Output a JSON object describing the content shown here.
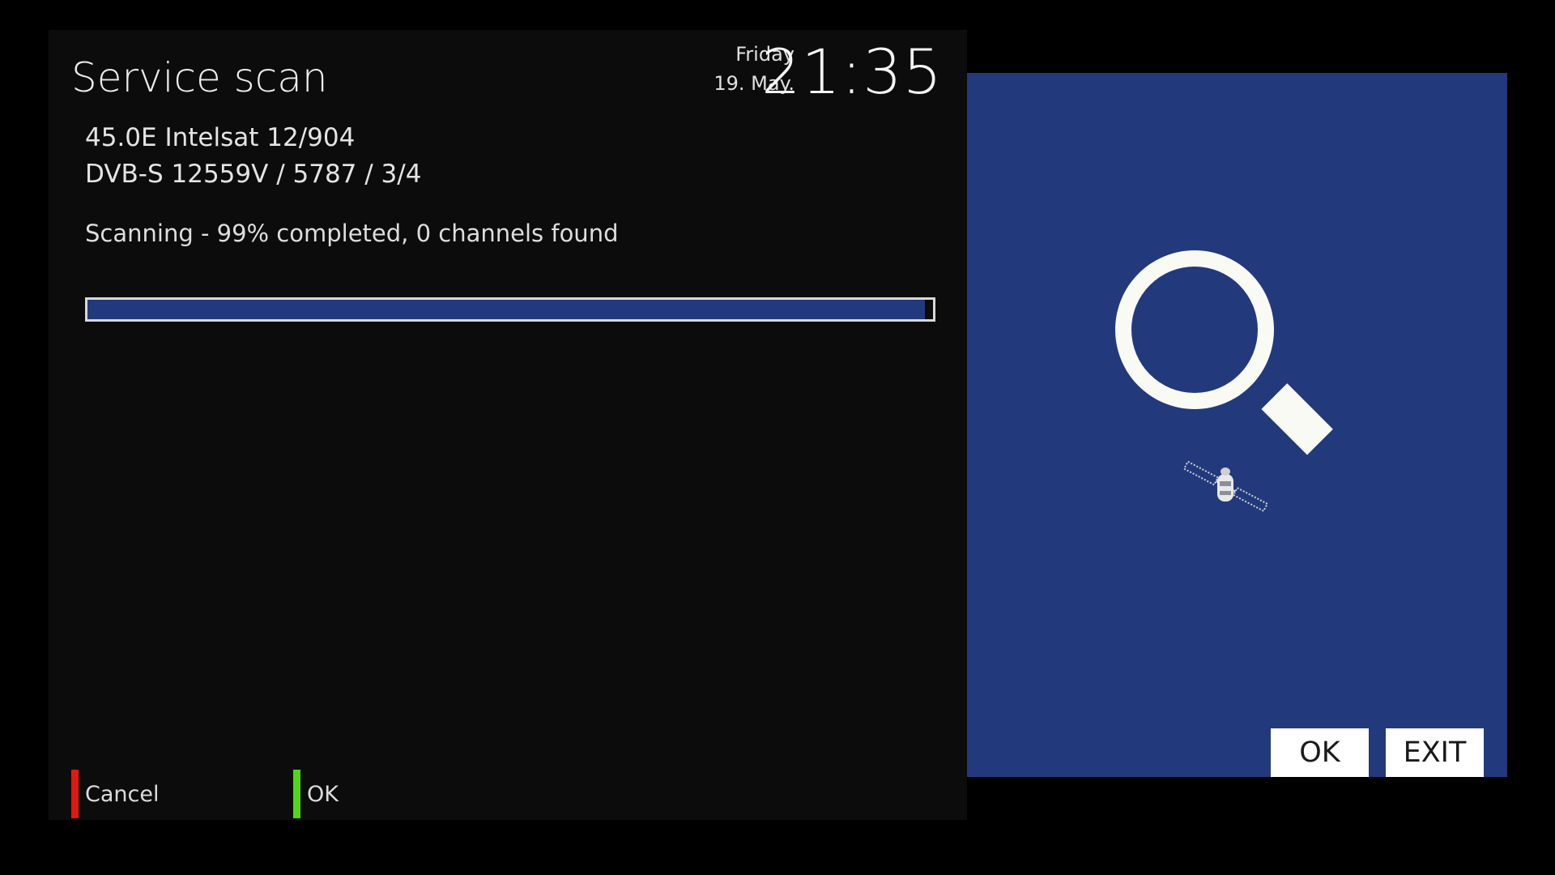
{
  "header": {
    "title": "Service scan",
    "day": "Friday",
    "date": "19. May.",
    "time": "21:35"
  },
  "scan": {
    "satellite": "45.0E Intelsat 12/904",
    "transponder": "DVB-S 12559V / 5787 / 3/4",
    "status": "Scanning - 99% completed, 0 channels found",
    "progress_percent": 99
  },
  "footer": {
    "cancel_label": "Cancel",
    "ok_label": "OK"
  },
  "side_panel": {
    "ok_button": "OK",
    "exit_button": "EXIT",
    "icons": [
      "magnifier-icon",
      "satellite-icon"
    ]
  },
  "colors": {
    "screen_background": "#000000",
    "dialog_background": "#0c0c0c",
    "panel_blue": "#223a7c",
    "progress_fill": "#223a7c",
    "progress_border": "#d8d8d8",
    "red_key": "#e3180e",
    "green_key": "#52d61a",
    "icon_white": "#fafaf5"
  }
}
